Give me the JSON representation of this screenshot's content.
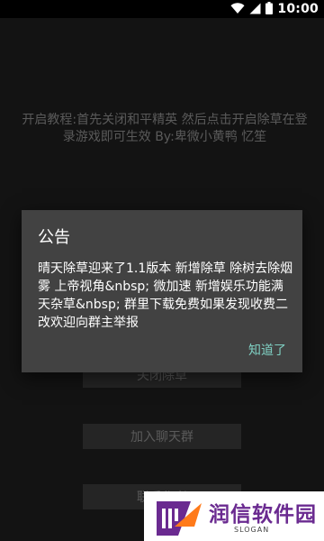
{
  "status_bar": {
    "time": "10:00",
    "icons": [
      "wifi-icon",
      "signal-icon",
      "battery-icon"
    ]
  },
  "background": {
    "tutorial_text": "开启教程:首先关闭和平精英 然后点击开启除草在登录游戏即可生效 By:卑微小黄鸭 忆笙",
    "buttons": {
      "close_weed": "关闭除草",
      "join_group": "加入聊天群",
      "contact": "联系作者"
    }
  },
  "dialog": {
    "title": "公告",
    "message": "晴天除草迎来了1.1版本 新增除草 除树去除烟雾 上帝视角&nbsp; 微加速 新增娱乐功能满天杂草&nbsp; 群里下载免费如果发现收费二改欢迎向群主举报",
    "button": "知道了"
  },
  "watermark": {
    "text": "润信软件园",
    "slogan": "SLOGAN"
  },
  "colors": {
    "dialog_bg": "#424242",
    "accent": "#7fcfc2",
    "watermark_purple": "#6a2a90"
  }
}
